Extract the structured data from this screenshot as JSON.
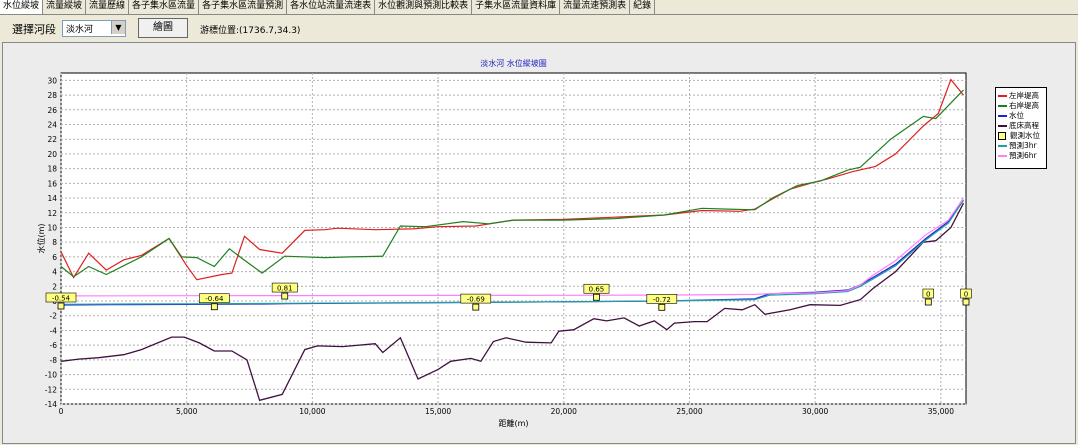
{
  "tabs": [
    "水位縱坡",
    "流量縱坡",
    "流量歷線",
    "各子集水區流量",
    "各子集水區流量預測",
    "各水位站流量流速表",
    "水位觀測與預測比較表",
    "子集水區流量資料庫",
    "流量流速預測表",
    "紀錄"
  ],
  "toolbar": {
    "river_label": "選擇河段",
    "river_value": "淡水河",
    "draw_label": "繪圖",
    "coord_text": "游標位置:(1736.7,34.3)"
  },
  "colors": {
    "left_bank": "#e02020",
    "right_bank": "#208020",
    "water_level": "#2020e0",
    "bed": "#401040",
    "forecast_3hr": "#20a0a0",
    "forecast_6hr": "#ff80ff",
    "observed_box": "#ffff80"
  },
  "chart_data": {
    "type": "line",
    "title": "淡水河 水位縱坡圖",
    "xlabel": "距離(m)",
    "ylabel": "水位(m)",
    "xlim": [
      0,
      36000
    ],
    "ylim": [
      -14,
      31
    ],
    "xticks": [
      0,
      5000,
      10000,
      15000,
      20000,
      25000,
      30000,
      35000
    ],
    "xtick_labels": [
      "0",
      "5,000",
      "10,000",
      "15,000",
      "20,000",
      "25,000",
      "30,000",
      "35,000"
    ],
    "yticks": [
      -14,
      -12,
      -10,
      -8,
      -6,
      -4,
      -2,
      0,
      2,
      4,
      6,
      8,
      10,
      12,
      14,
      16,
      18,
      20,
      22,
      24,
      26,
      28,
      30
    ],
    "grid": true,
    "legend_position": "right",
    "series": [
      {
        "name": "左岸堤高",
        "key": "left_bank",
        "points": [
          [
            0,
            6.7
          ],
          [
            500,
            3.2
          ],
          [
            1100,
            6.5
          ],
          [
            1800,
            4.2
          ],
          [
            2500,
            5.6
          ],
          [
            3200,
            6.2
          ],
          [
            4300,
            8.5
          ],
          [
            5000,
            4.8
          ],
          [
            5400,
            2.9
          ],
          [
            6400,
            3.6
          ],
          [
            6800,
            3.8
          ],
          [
            7300,
            8.8
          ],
          [
            7900,
            7
          ],
          [
            8800,
            6.5
          ],
          [
            9700,
            9.6
          ],
          [
            10500,
            9.7
          ],
          [
            11000,
            9.9
          ],
          [
            12500,
            9.7
          ],
          [
            14000,
            9.8
          ],
          [
            15000,
            10.1
          ],
          [
            16500,
            10.2
          ],
          [
            18000,
            11
          ],
          [
            20000,
            11.1
          ],
          [
            22000,
            11.4
          ],
          [
            24000,
            11.7
          ],
          [
            25500,
            12.3
          ],
          [
            27000,
            12.2
          ],
          [
            27600,
            12.5
          ],
          [
            28200,
            13.7
          ],
          [
            29000,
            15.2
          ],
          [
            30000,
            16.2
          ],
          [
            30500,
            16.6
          ],
          [
            31500,
            17.6
          ],
          [
            32400,
            18.3
          ],
          [
            33200,
            20
          ],
          [
            34300,
            23.8
          ],
          [
            34900,
            25.5
          ],
          [
            35400,
            30.1
          ],
          [
            35900,
            28
          ]
        ]
      },
      {
        "name": "右岸堤高",
        "key": "right_bank",
        "points": [
          [
            0,
            4.7
          ],
          [
            500,
            3.3
          ],
          [
            1100,
            4.7
          ],
          [
            1800,
            3.6
          ],
          [
            2500,
            4.8
          ],
          [
            3200,
            6
          ],
          [
            4300,
            8.5
          ],
          [
            4800,
            6
          ],
          [
            5400,
            5.9
          ],
          [
            6100,
            4.7
          ],
          [
            6700,
            7.1
          ],
          [
            7200,
            5.8
          ],
          [
            8000,
            3.8
          ],
          [
            8900,
            6.1
          ],
          [
            10500,
            5.9
          ],
          [
            11500,
            6
          ],
          [
            12800,
            6.1
          ],
          [
            13500,
            10.2
          ],
          [
            14500,
            10.1
          ],
          [
            16000,
            10.8
          ],
          [
            17000,
            10.5
          ],
          [
            18000,
            11
          ],
          [
            20000,
            11
          ],
          [
            22000,
            11.2
          ],
          [
            24000,
            11.7
          ],
          [
            25500,
            12.6
          ],
          [
            26500,
            12.5
          ],
          [
            27600,
            12.4
          ],
          [
            28300,
            14
          ],
          [
            29300,
            15.7
          ],
          [
            30200,
            16.3
          ],
          [
            31300,
            17.8
          ],
          [
            31800,
            18.2
          ],
          [
            33000,
            22
          ],
          [
            34300,
            25.1
          ],
          [
            34800,
            24.8
          ],
          [
            35900,
            28.7
          ]
        ]
      },
      {
        "name": "水位",
        "key": "water_level",
        "points": [
          [
            0,
            -0.54
          ],
          [
            2000,
            -0.5
          ],
          [
            5000,
            -0.46
          ],
          [
            6000,
            -0.44
          ],
          [
            8000,
            -0.4
          ],
          [
            9000,
            -0.35
          ],
          [
            12000,
            -0.3
          ],
          [
            16000,
            -0.2
          ],
          [
            20000,
            -0.1
          ],
          [
            24000,
            0
          ],
          [
            27600,
            0.3
          ],
          [
            28200,
            1
          ],
          [
            30000,
            1.2
          ],
          [
            31300,
            1.5
          ],
          [
            31800,
            2.2
          ],
          [
            32300,
            3.2
          ],
          [
            33200,
            5
          ],
          [
            34400,
            8.5
          ],
          [
            35300,
            10.8
          ],
          [
            35900,
            13.7
          ]
        ]
      },
      {
        "name": "底床高程",
        "key": "bed",
        "points": [
          [
            0,
            -8.2
          ],
          [
            700,
            -7.9
          ],
          [
            1500,
            -7.7
          ],
          [
            2500,
            -7.3
          ],
          [
            3200,
            -6.6
          ],
          [
            4400,
            -4.9
          ],
          [
            4900,
            -4.9
          ],
          [
            5500,
            -5.7
          ],
          [
            6100,
            -6.8
          ],
          [
            6800,
            -6.8
          ],
          [
            7400,
            -8
          ],
          [
            7900,
            -13.5
          ],
          [
            8800,
            -12.7
          ],
          [
            9700,
            -6.6
          ],
          [
            10200,
            -6.1
          ],
          [
            11200,
            -6.2
          ],
          [
            12500,
            -5.8
          ],
          [
            12800,
            -7
          ],
          [
            13500,
            -5
          ],
          [
            14200,
            -10.6
          ],
          [
            15000,
            -9.3
          ],
          [
            15500,
            -8.2
          ],
          [
            16300,
            -7.8
          ],
          [
            16700,
            -8.2
          ],
          [
            17200,
            -5.5
          ],
          [
            17700,
            -5
          ],
          [
            18500,
            -5.6
          ],
          [
            19500,
            -5.7
          ],
          [
            19800,
            -4.1
          ],
          [
            20400,
            -3.9
          ],
          [
            21200,
            -2.4
          ],
          [
            21700,
            -2.7
          ],
          [
            22400,
            -2.3
          ],
          [
            23000,
            -3.4
          ],
          [
            23600,
            -2.7
          ],
          [
            24100,
            -3.9
          ],
          [
            24400,
            -3
          ],
          [
            25200,
            -2.8
          ],
          [
            25700,
            -2.8
          ],
          [
            26400,
            -1
          ],
          [
            27100,
            -1.2
          ],
          [
            27600,
            -0.5
          ],
          [
            28000,
            -1.8
          ],
          [
            29000,
            -1.2
          ],
          [
            29800,
            -0.5
          ],
          [
            31000,
            -0.6
          ],
          [
            31800,
            0.2
          ],
          [
            32300,
            1.7
          ],
          [
            33200,
            4
          ],
          [
            34300,
            8
          ],
          [
            34800,
            8.2
          ],
          [
            35400,
            10
          ],
          [
            35900,
            13.3
          ]
        ]
      },
      {
        "name": "預測3hr",
        "key": "forecast_3hr",
        "points": [
          [
            0,
            -0.45
          ],
          [
            5000,
            -0.38
          ],
          [
            10000,
            -0.3
          ],
          [
            15000,
            -0.2
          ],
          [
            20000,
            -0.1
          ],
          [
            24000,
            0
          ],
          [
            27600,
            0.2
          ],
          [
            28200,
            0.8
          ],
          [
            30000,
            1
          ],
          [
            31300,
            1.3
          ],
          [
            31800,
            2
          ],
          [
            32300,
            3
          ],
          [
            33200,
            4.8
          ],
          [
            34400,
            8.3
          ],
          [
            35300,
            10.6
          ],
          [
            35900,
            13.7
          ]
        ]
      },
      {
        "name": "預測6hr",
        "key": "forecast_6hr",
        "points": [
          [
            0,
            0.7
          ],
          [
            5000,
            0.72
          ],
          [
            10000,
            0.74
          ],
          [
            15000,
            0.76
          ],
          [
            20000,
            0.78
          ],
          [
            24000,
            0.8
          ],
          [
            27600,
            0.9
          ],
          [
            28200,
            1
          ],
          [
            30000,
            1.1
          ],
          [
            31300,
            1.4
          ],
          [
            31800,
            2.2
          ],
          [
            32300,
            3.5
          ],
          [
            33200,
            5.5
          ],
          [
            34400,
            9
          ],
          [
            35300,
            11
          ],
          [
            35900,
            14
          ]
        ]
      }
    ],
    "observed": {
      "name": "觀測水位",
      "points": [
        {
          "x": 0,
          "y": -0.54,
          "label": "-0.54"
        },
        {
          "x": 6100,
          "y": -0.64,
          "label": "-0.64"
        },
        {
          "x": 8900,
          "y": 0.81,
          "label": "0.81"
        },
        {
          "x": 16500,
          "y": -0.69,
          "label": "-0.69"
        },
        {
          "x": 21300,
          "y": 0.65,
          "label": "0.65"
        },
        {
          "x": 23900,
          "y": -0.72,
          "label": "-0.72"
        },
        {
          "x": 34500,
          "y": 0,
          "label": "0"
        },
        {
          "x": 36000,
          "y": 0,
          "label": "0"
        }
      ]
    }
  }
}
